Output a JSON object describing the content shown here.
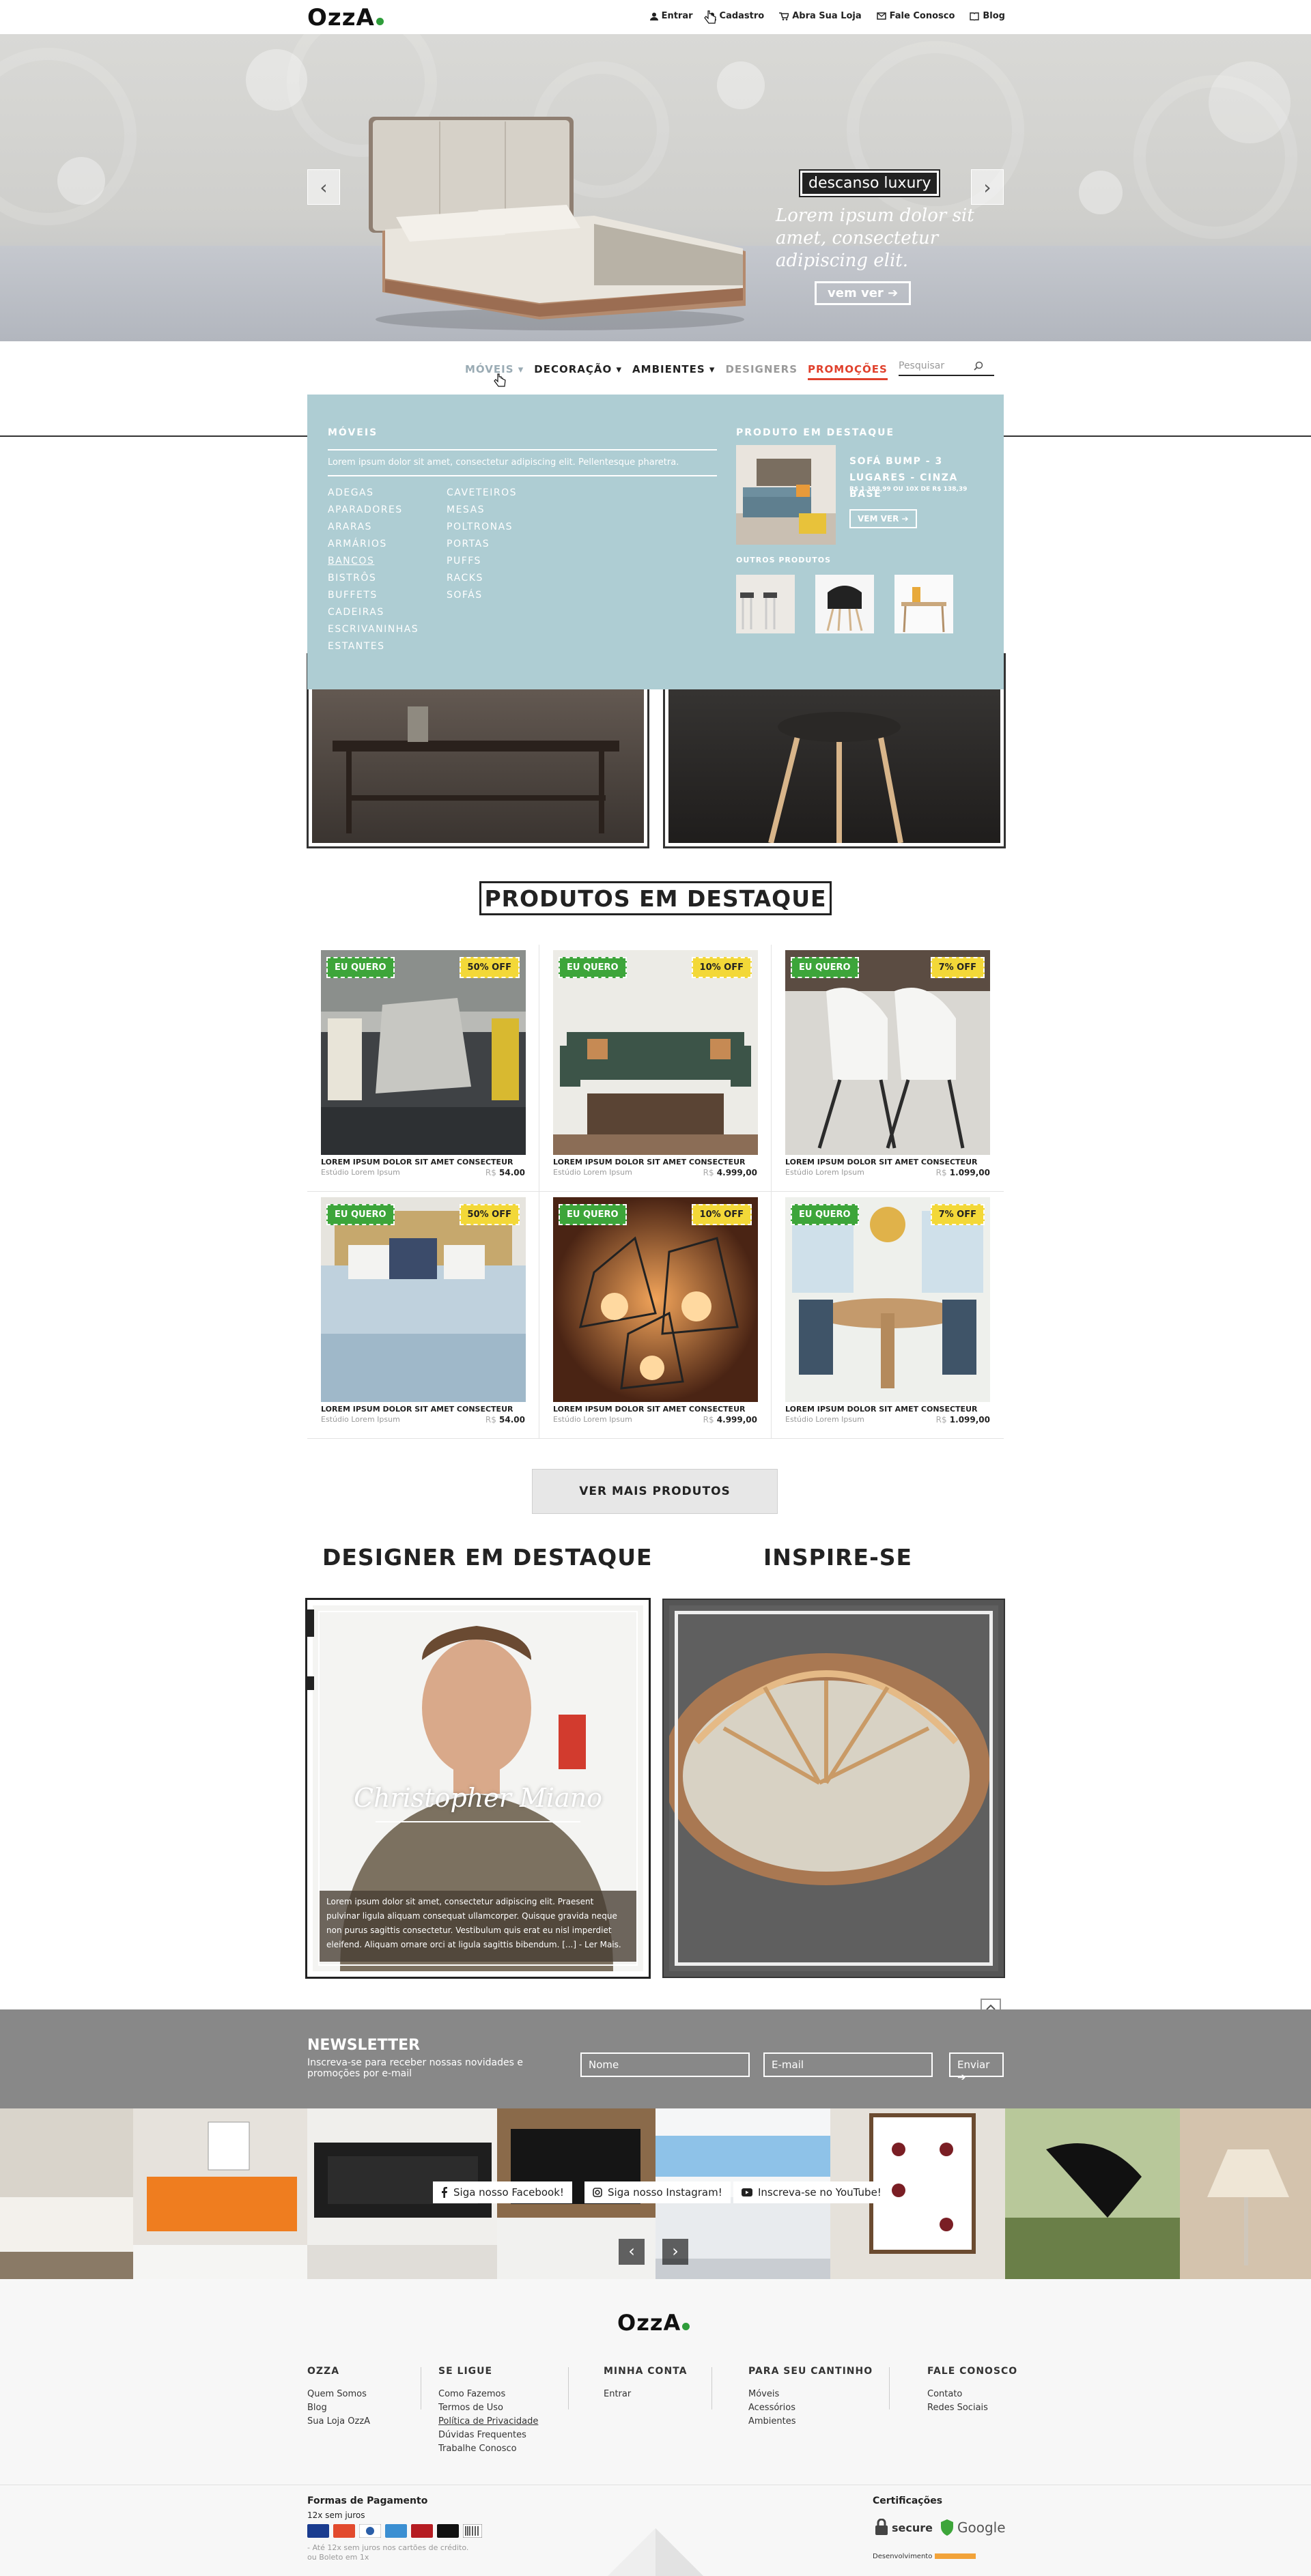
{
  "brand": {
    "logo": "OzzA"
  },
  "topbar": {
    "links": [
      {
        "label": "Entrar",
        "icon": "user-icon"
      },
      {
        "label": "Cadastro",
        "icon": "person-add-icon"
      },
      {
        "label": "Abra Sua Loja",
        "icon": "cart-icon"
      },
      {
        "label": "Fale Conosco",
        "icon": "mail-icon"
      },
      {
        "label": "Blog",
        "icon": "book-icon"
      }
    ]
  },
  "hero": {
    "tag": "descanso luxury",
    "text": "Lorem ipsum dolor sit amet, consectetur adipiscing elit.",
    "button": "vem ver",
    "prev": "‹",
    "next": "›",
    "dots": 3,
    "active_dot": 3
  },
  "nav": {
    "items": [
      {
        "label": "MÓVEIS",
        "color": "#9aabb4"
      },
      {
        "label": "DECORAÇÃO",
        "color": "#222"
      },
      {
        "label": "AMBIENTES",
        "color": "#222"
      },
      {
        "label": "DESIGNERS",
        "color": "#9a9a9a"
      },
      {
        "label": "PROMOÇÕES",
        "color": "#e0402c"
      }
    ],
    "search_placeholder": "Pesquisar"
  },
  "mega_menu": {
    "title": "MÓVEIS",
    "intro": "Lorem ipsum dolor sit amet, consectetur adipiscing elit. Pellentesque pharetra.",
    "col1": [
      "ADEGAS",
      "APARADORES",
      "ARARAS",
      "ARMÁRIOS",
      "BANCOS",
      "BISTRÔS",
      "BUFFETS",
      "CADEIRAS",
      "ESCRIVANINHAS",
      "ESTANTES"
    ],
    "col2": [
      "CAVETEIROS",
      "MESAS",
      "POLTRONAS",
      "PORTAS",
      "PUFFS",
      "RACKS",
      "SOFÁS"
    ],
    "featured_title": "PRODUTO EM DESTAQUE",
    "featured_name": "SOFÁ BUMP - 3 LUGARES - CINZA BASE",
    "featured_price": "R$ 1.388,99 OU 10X DE R$ 138,39",
    "featured_button": "VEM VER",
    "others_title": "OUTROS PRODUTOS"
  },
  "products": {
    "title": "PRODUTOS EM DESTAQUE",
    "items": [
      {
        "badge": "EU QUERO",
        "off": "50% OFF",
        "name": "LOREM IPSUM DOLOR SIT AMET CONSECTEUR",
        "brand": "Estúdio Lorem Ipsum",
        "currency": "R$",
        "price": "54.00",
        "img": "sofa-pillow"
      },
      {
        "badge": "EU QUERO",
        "off": "10% OFF",
        "name": "LOREM IPSUM DOLOR SIT AMET CONSECTEUR",
        "brand": "Estúdio Lorem Ipsum",
        "currency": "R$",
        "price": "4.999,00",
        "img": "green-sofa"
      },
      {
        "badge": "EU QUERO",
        "off": "7% OFF",
        "name": "LOREM IPSUM DOLOR SIT AMET CONSECTEUR",
        "brand": "Estúdio Lorem Ipsum",
        "currency": "R$",
        "price": "1.099,00",
        "img": "white-chairs"
      },
      {
        "badge": "EU QUERO",
        "off": "50% OFF",
        "name": "LOREM IPSUM DOLOR SIT AMET CONSECTEUR",
        "brand": "Estúdio Lorem Ipsum",
        "currency": "R$",
        "price": "54.00",
        "img": "blue-bed"
      },
      {
        "badge": "EU QUERO",
        "off": "10% OFF",
        "name": "LOREM IPSUM DOLOR SIT AMET CONSECTEUR",
        "brand": "Estúdio Lorem Ipsum",
        "currency": "R$",
        "price": "4.999,00",
        "img": "pendant-lamps"
      },
      {
        "badge": "EU QUERO",
        "off": "7% OFF",
        "name": "LOREM IPSUM DOLOR SIT AMET CONSECTEUR",
        "brand": "Estúdio Lorem Ipsum",
        "currency": "R$",
        "price": "1.099,00",
        "img": "dining-room"
      }
    ],
    "more_button": "VER MAIS PRODUTOS"
  },
  "designer": {
    "title": "DESIGNER EM DESTAQUE",
    "name": "Christopher Miano",
    "bio": "Lorem ipsum dolor sit amet, consectetur adipiscing elit. Praesent pulvinar ligula aliquam consequat ullamcorper. Quisque gravida neque non purus sagittis consectetur. Vestibulum quis erat eu nisl imperdiet eleifend. Aliquam ornare orci at ligula sagittis bibendum. [...] - Ler Mais."
  },
  "inspire": {
    "title": "INSPIRE-SE"
  },
  "newsletter": {
    "title": "NEWSLETTER",
    "subtitle": "Inscreva-se para receber nossas novidades e promoções por e-mail",
    "name_placeholder": "Nome",
    "email_placeholder": "E-mail",
    "submit": "Enviar"
  },
  "social": {
    "facebook": "Siga nosso Facebook!",
    "instagram": "Siga nosso Instagram!",
    "youtube": "Inscreva-se no YouTube!"
  },
  "footer": {
    "columns": [
      {
        "title": "OZZA",
        "links": [
          "Quem Somos",
          "Blog",
          "Sua Loja OzzA"
        ]
      },
      {
        "title": "SE LIGUE",
        "links": [
          "Como Fazemos",
          "Termos de Uso",
          "Política de Privacidade",
          "Dúvidas Frequentes",
          "Trabalhe Conosco"
        ]
      },
      {
        "title": "MINHA CONTA",
        "links": [
          "Entrar"
        ]
      },
      {
        "title": "PARA SEU CANTINHO",
        "links": [
          "Móveis",
          "Acessórios",
          "Ambientes"
        ]
      },
      {
        "title": "FALE CONOSCO",
        "links": [
          "Contato",
          "Redes Sociais"
        ]
      }
    ],
    "payment_title": "Formas de Pagamento",
    "payment_sub": "12x sem juros",
    "payment_note1": "- Até 12x sem juros nos cartões de crédito.",
    "payment_note2": "ou Boleto em 1x",
    "cert_title": "Certificações",
    "cert_secure": "secure",
    "cert_google": "Google",
    "dev_label": "Desenvolvimento"
  }
}
